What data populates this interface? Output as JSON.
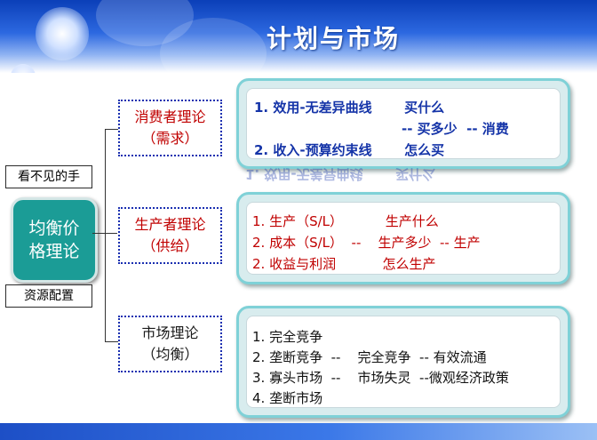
{
  "title": "计划与市场",
  "left": {
    "top_label": "看不见的手",
    "center_line1": "均衡价",
    "center_line2": "格理论",
    "bottom_label": "资源配置"
  },
  "theories": [
    {
      "line1": "消费者理论",
      "line2": "（需求）"
    },
    {
      "line1": "生产者理论",
      "line2": "（供给）"
    },
    {
      "line1": "市场理论",
      "line2": "（均衡）"
    }
  ],
  "panel1": [
    "1. 效用-无差异曲线       买什么",
    "-- 买多少  -- 消费",
    "2. 收入-预算约束线       怎么买"
  ],
  "panel2": [
    "1. 生产（S/L）          生产什么",
    "2. 成本（S/L）  --    生产多少  -- 生产",
    "2. 收益与利润           怎么生产"
  ],
  "panel3": [
    "1. 完全竞争",
    "2. 垄断竞争  --    完全竞争  -- 有效流通",
    "3. 寡头市场  --    市场失灵  --微观经济政策",
    "4. 垄断市场"
  ]
}
